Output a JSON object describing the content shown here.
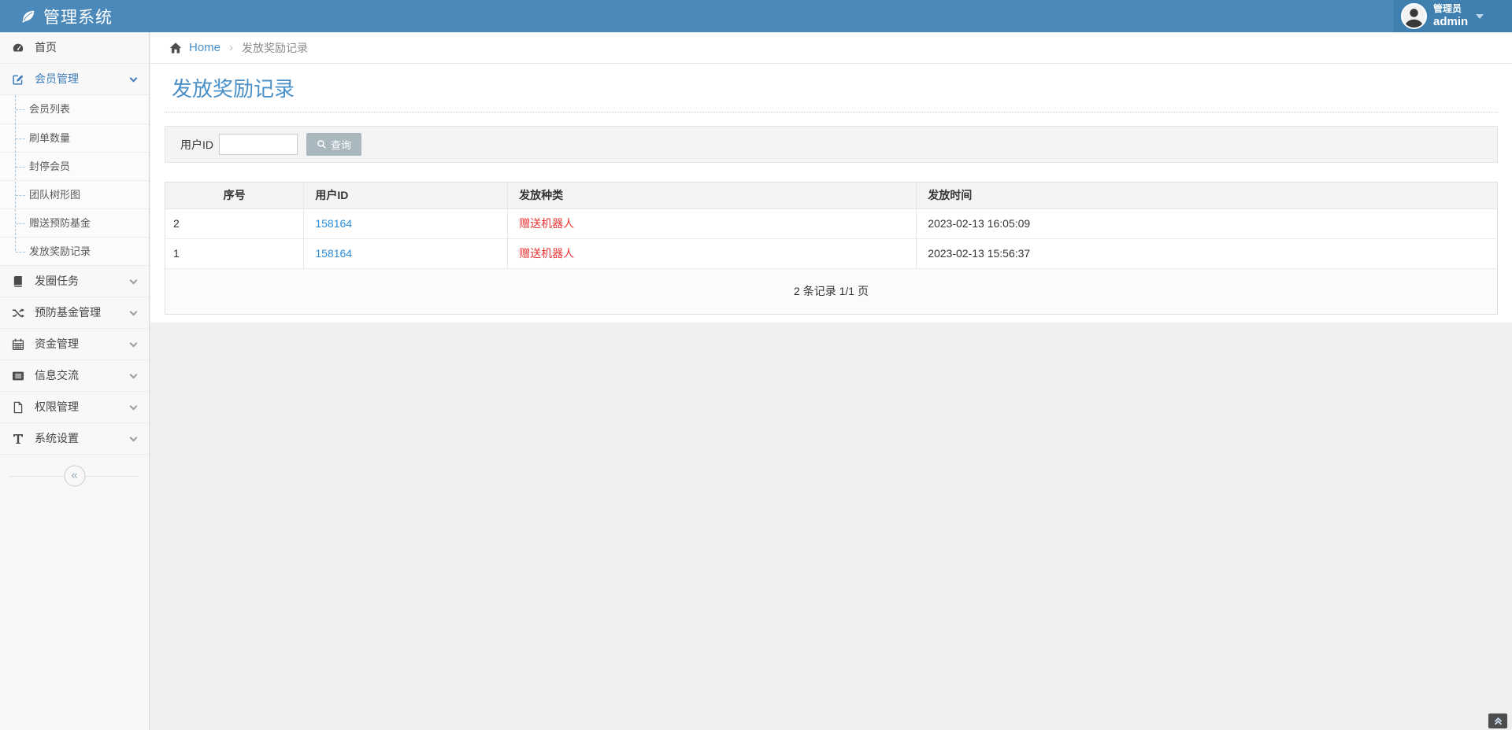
{
  "header": {
    "app_title": "管理系统",
    "logo_icon": "leaf-icon",
    "user_role": "管理员",
    "user_name": "admin"
  },
  "sidebar": {
    "items": [
      {
        "label": "首页",
        "icon": "dashboard-icon",
        "expandable": false
      },
      {
        "label": "会员管理",
        "icon": "edit-icon",
        "expandable": true,
        "expanded": true,
        "active": true,
        "children": [
          "会员列表",
          "刷单数量",
          "封停会员",
          "团队树形图",
          "赠送预防基金",
          "发放奖励记录"
        ]
      },
      {
        "label": "发圈任务",
        "icon": "book-icon",
        "expandable": true
      },
      {
        "label": "预防基金管理",
        "icon": "shuffle-icon",
        "expandable": true
      },
      {
        "label": "资金管理",
        "icon": "calendar-icon",
        "expandable": true
      },
      {
        "label": "信息交流",
        "icon": "list-icon",
        "expandable": true
      },
      {
        "label": "权限管理",
        "icon": "file-icon",
        "expandable": true
      },
      {
        "label": "系统设置",
        "icon": "text-icon",
        "expandable": true
      }
    ],
    "collapse_glyph": "«"
  },
  "breadcrumb": {
    "home_icon": "home-icon",
    "home": "Home",
    "separator": "›",
    "current": "发放奖励记录"
  },
  "page": {
    "title": "发放奖励记录"
  },
  "search": {
    "label": "用户ID",
    "input_value": "",
    "input_placeholder": "",
    "button_label": "查询",
    "button_icon": "search-icon"
  },
  "table": {
    "headers": [
      "序号",
      "用户ID",
      "发放种类",
      "发放时间"
    ],
    "rows": [
      {
        "seq": "2",
        "user_id": "158164",
        "type": "赠送机器人",
        "time": "2023-02-13 16:05:09"
      },
      {
        "seq": "1",
        "user_id": "158164",
        "type": "赠送机器人",
        "time": "2023-02-13 15:56:37"
      }
    ],
    "pagination": "2 条记录 1/1 页"
  },
  "colors": {
    "header_bg": "#4a89ba",
    "user_box_bg": "#4080b1",
    "accent_blue": "#4a90c8",
    "active_menu_blue": "#3e7cba",
    "link_blue": "#2d8cd8",
    "danger_red": "#e93333",
    "button_gray": "#a9b7be"
  }
}
